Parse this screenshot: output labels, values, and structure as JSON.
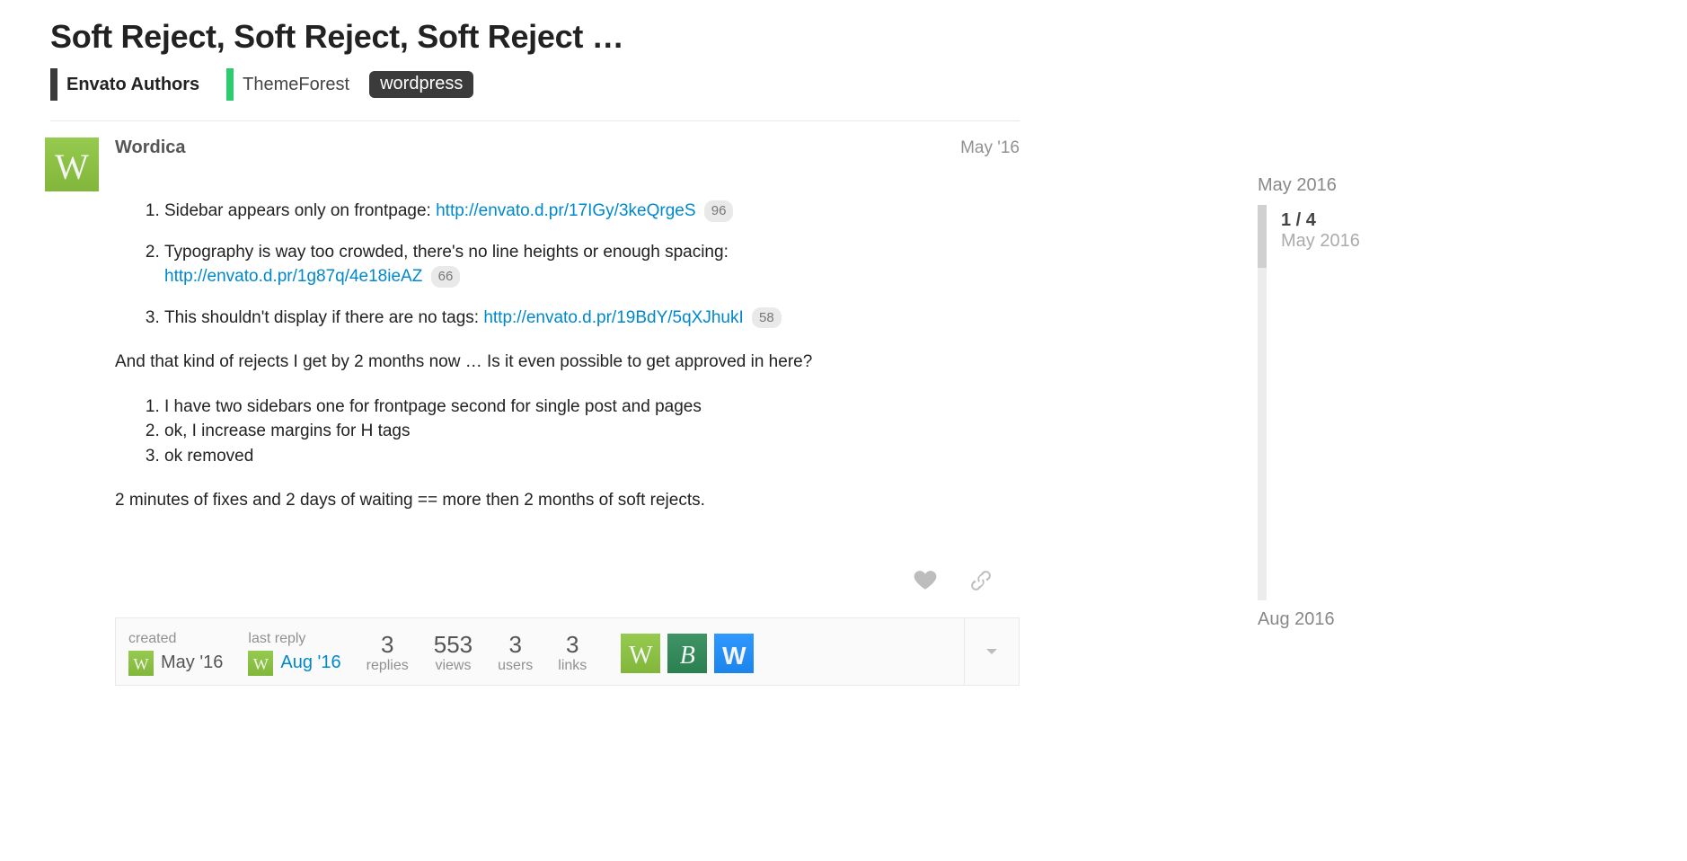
{
  "topic": {
    "title": "Soft Reject, Soft Reject, Soft Reject …",
    "cat1": "Envato Authors",
    "cat2": "ThemeForest",
    "tag": "wordpress"
  },
  "post": {
    "author": "Wordica",
    "avatar_letter": "W",
    "date": "May '16",
    "items1": {
      "t1": "Sidebar appears only on frontpage: ",
      "l1": "http://envato.d.pr/17IGy/3keQrgeS",
      "b1": "96",
      "t2": "Typography is way too crowded, there's no line heights or enough spacing: ",
      "l2": "http://envato.d.pr/1g87q/4e18ieAZ",
      "b2": "66",
      "t3": "This shouldn't display if there are no tags: ",
      "l3": "http://envato.d.pr/19BdY/5qXJhukI",
      "b3": "58"
    },
    "p1": "And that kind of rejects I get by 2 months now … Is it even possible to get approved in here?",
    "items2": {
      "r1": "I have two sidebars one for frontpage second for single post and pages",
      "r2": "ok, I increase margins for H tags",
      "r3": "ok removed"
    },
    "p2": "2 minutes of fixes and 2 days of waiting == more then 2 months of soft rejects."
  },
  "map": {
    "created_label": "created",
    "created_date": "May '16",
    "created_avatar": "W",
    "lastreply_label": "last reply",
    "lastreply_date": "Aug '16",
    "lastreply_avatar": "W",
    "stats": {
      "replies_num": "3",
      "replies_label": "replies",
      "views_num": "553",
      "views_label": "views",
      "users_num": "3",
      "users_label": "users",
      "links_num": "3",
      "links_label": "links"
    },
    "participants": {
      "p1": "W",
      "p2": "B",
      "p3": "W"
    }
  },
  "timeline": {
    "top": "May 2016",
    "pos": "1 / 4",
    "posdate": "May 2016",
    "bottom": "Aug 2016"
  }
}
